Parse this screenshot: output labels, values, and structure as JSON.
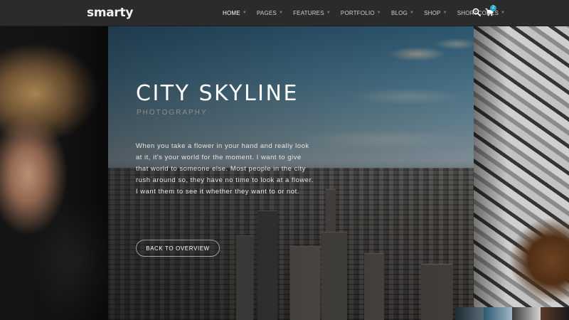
{
  "header": {
    "logo": "smarty",
    "nav": [
      {
        "label": "HOME",
        "active": true
      },
      {
        "label": "PAGES",
        "active": false
      },
      {
        "label": "FEATURES",
        "active": false
      },
      {
        "label": "PORTFOLIO",
        "active": false
      },
      {
        "label": "BLOG",
        "active": false
      },
      {
        "label": "SHOP",
        "active": false
      },
      {
        "label": "SHORTCODES",
        "active": false
      }
    ],
    "search_icon": "search-icon",
    "cart_icon": "cart-icon",
    "cart_count": "2"
  },
  "hero": {
    "title": "CITY SKYLINE",
    "subtitle": "PHOTOGRAPHY",
    "body": "When you take a flower in your hand and really look at it, it's your world for the moment. I want to give that world to someone else. Most people in the city rush around so, they have no time to look at a flower. I want them to see it whether they want to or not.",
    "button_label": "BACK TO OVERVIEW"
  },
  "colors": {
    "header_bg": "#2b2b2b",
    "accent": "#29a3cc"
  }
}
